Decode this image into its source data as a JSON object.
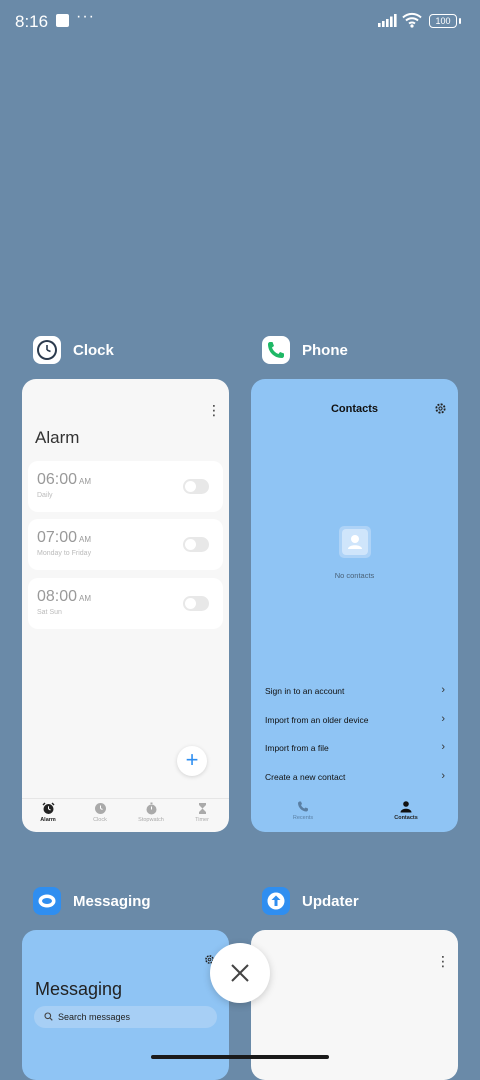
{
  "status_bar": {
    "time": "8:16",
    "dots": "···",
    "battery": "100",
    "icons": [
      "notification-square-icon",
      "more-dots-icon",
      "signal-icon",
      "wifi-icon",
      "battery-icon"
    ]
  },
  "colors": {
    "background": "#6a8aa8",
    "card_light": "#f7f7f7",
    "card_blue": "#8fc4f4",
    "accent": "#2f8ef0"
  },
  "apps": {
    "clock": {
      "name": "Clock",
      "icon": "clock-app-icon",
      "screen_title": "Alarm",
      "alarms": [
        {
          "time": "06:00",
          "ampm": "AM",
          "label": "Daily",
          "enabled": false
        },
        {
          "time": "07:00",
          "ampm": "AM",
          "label": "Monday to Friday",
          "enabled": false
        },
        {
          "time": "08:00",
          "ampm": "AM",
          "label": "Sat Sun",
          "enabled": false
        }
      ],
      "fab": "+",
      "nav": [
        {
          "label": "Alarm",
          "icon": "alarm-icon",
          "active": true
        },
        {
          "label": "Clock",
          "icon": "clock-icon",
          "active": false
        },
        {
          "label": "Stopwatch",
          "icon": "stopwatch-icon",
          "active": false
        },
        {
          "label": "Timer",
          "icon": "hourglass-icon",
          "active": false
        }
      ]
    },
    "phone": {
      "name": "Phone",
      "icon": "phone-app-icon",
      "screen_title": "Contacts",
      "empty_text": "No contacts",
      "actions": [
        "Sign in to an account",
        "Import from an older device",
        "Import from a file",
        "Create a new contact"
      ],
      "nav": [
        {
          "label": "Recents",
          "icon": "phone-icon",
          "active": false
        },
        {
          "label": "Contacts",
          "icon": "person-icon",
          "active": true
        }
      ]
    },
    "messaging": {
      "name": "Messaging",
      "icon": "messaging-app-icon",
      "screen_title": "Messaging",
      "search_placeholder": "Search messages"
    },
    "updater": {
      "name": "Updater",
      "icon": "updater-app-icon"
    }
  },
  "close_all": "close-icon"
}
